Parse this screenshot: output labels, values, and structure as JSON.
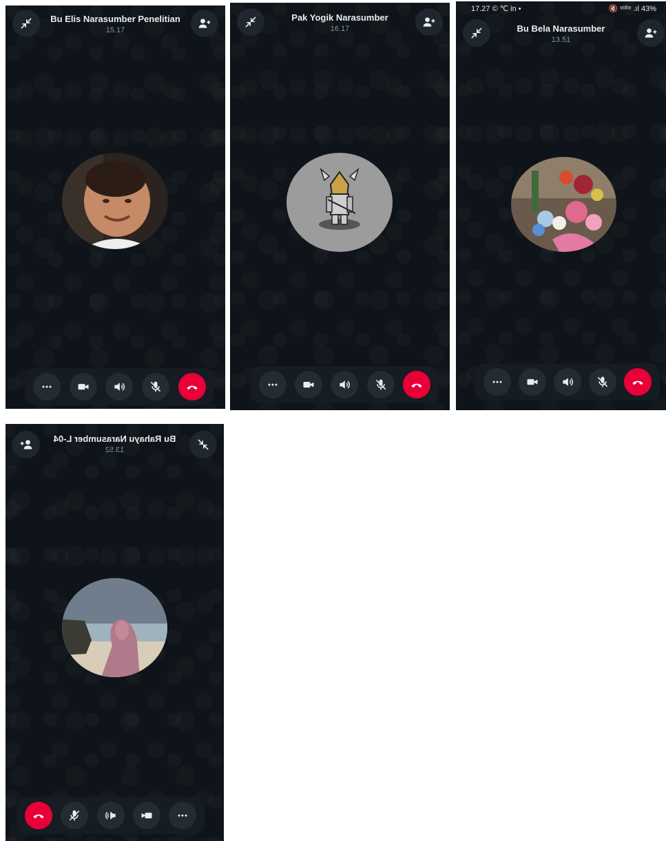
{
  "colors": {
    "background": "#0f141a",
    "control_bar": "#161c22",
    "button": "#232b33",
    "end_call": "#ea0038",
    "text": "#e9edef",
    "subtext": "#8696a0"
  },
  "status_bar": {
    "time": "17.27",
    "left_icons": "© ℃ in •",
    "right_icons": "🔇 ᵛᵒˡᵗᵉ .ıl",
    "battery": "43%"
  },
  "calls": [
    {
      "name": "Bu Elis Narasumber Penelitian",
      "time": "15.17",
      "avatar": "baby-photo"
    },
    {
      "name": "Pak Yogik Narasumber",
      "time": "16.17",
      "avatar": "knight-avatar"
    },
    {
      "name": "Bu Bela Narasumber",
      "time": "13.51",
      "avatar": "flowers-photo"
    },
    {
      "name": "Bu Rahayu Narasumber L-04",
      "time": "13.52",
      "avatar": "beach-hijab-photo"
    }
  ],
  "controls": [
    "more-icon",
    "video-icon",
    "speaker-icon",
    "mic-off-icon",
    "end-call-icon"
  ],
  "header_icons": [
    "minimize-icon",
    "add-participant-icon"
  ]
}
